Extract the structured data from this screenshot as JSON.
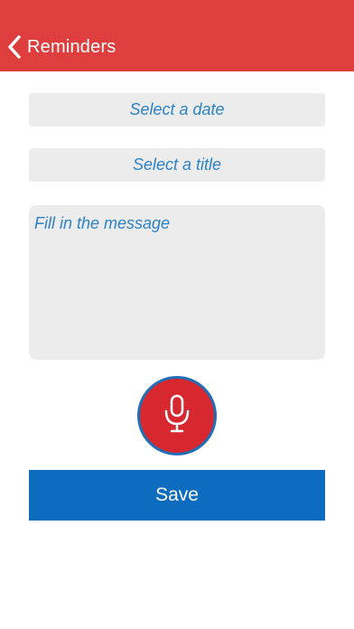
{
  "navbar": {
    "back_label": "Reminders",
    "background_color": "#df3e3e"
  },
  "form": {
    "date_placeholder": "Select a date",
    "title_placeholder": "Select a title",
    "message_placeholder": "Fill in the message",
    "field_text_color": "#2b82c6",
    "field_background": "#ececec"
  },
  "mic": {
    "icon": "microphone-icon",
    "color": "#d7282f",
    "ring_color": "#1f6fb8"
  },
  "actions": {
    "save_label": "Save",
    "save_color": "#0d6cbd"
  }
}
